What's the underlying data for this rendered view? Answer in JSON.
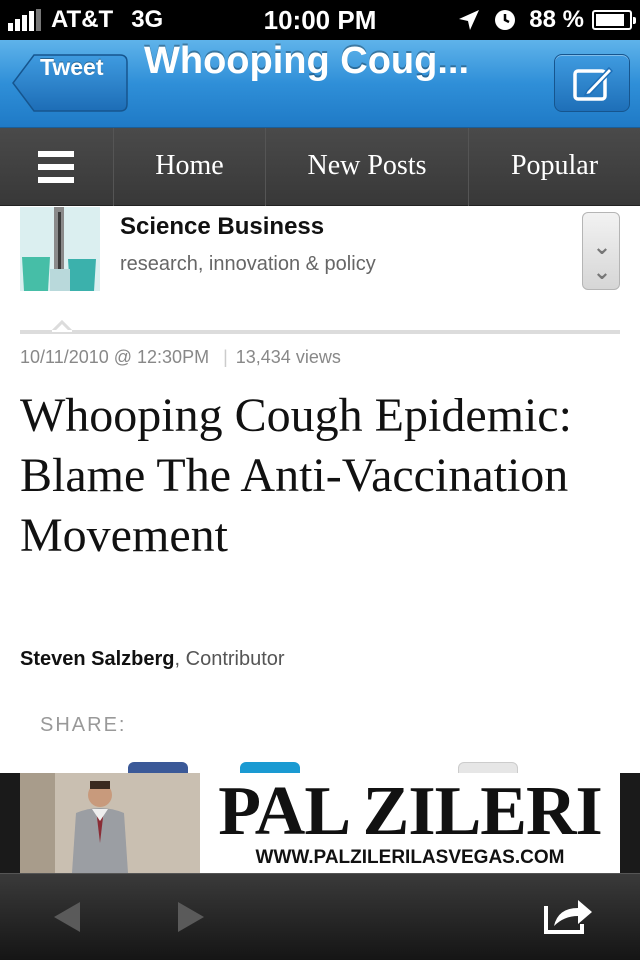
{
  "status_bar": {
    "carrier": "AT&T",
    "network": "3G",
    "time": "10:00 PM",
    "battery": "88 %",
    "battery_level": 0.88,
    "signal_bars": 4
  },
  "nav_bar": {
    "back_label": "Tweet",
    "title": "Whooping Coug...",
    "color": "#2f8fd8"
  },
  "menu": {
    "items": [
      {
        "label": "Home"
      },
      {
        "label": "New Posts"
      },
      {
        "label": "Popular"
      }
    ]
  },
  "blog": {
    "name": "Science Business",
    "tagline": "research, innovation & policy"
  },
  "article": {
    "date": "10/11/2010 @ 12:30PM",
    "views": "13,434 views",
    "headline": "Whooping Cough Epidemic: Blame The Anti-Vaccination Movement",
    "author": "Steven Salzberg",
    "author_role": ", Contributor",
    "share_label": "SHARE:"
  },
  "ad": {
    "brand": "PAL ZILERI",
    "url": "WWW.PALZILERILASVEGAS.COM"
  },
  "icons": {
    "back": "chevron-left-icon",
    "forward": "chevron-right-icon",
    "share": "share-arrow-icon",
    "compose": "compose-icon",
    "menu": "hamburger-icon"
  }
}
